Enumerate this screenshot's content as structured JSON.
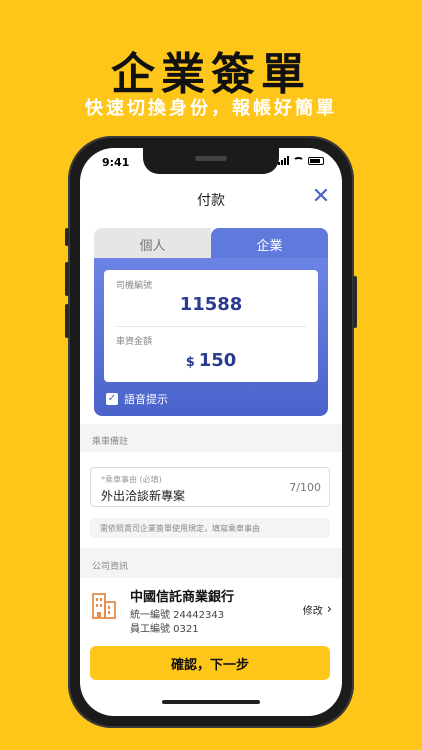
{
  "promo": {
    "headline": "企業簽單",
    "subline": "快速切換身份，報帳好簡單"
  },
  "status_bar": {
    "time": "9:41"
  },
  "nav": {
    "title": "付款"
  },
  "tabs": [
    {
      "label": "個人"
    },
    {
      "label": "企業"
    }
  ],
  "payment": {
    "driver_label": "司機編號",
    "driver_value": "11588",
    "fare_label": "車資金額",
    "currency": "$",
    "fare_value": "150",
    "voice_label": "語音提示",
    "voice_checked": true
  },
  "remarks": {
    "section_label": "乘車備註",
    "reason_placeholder": "*乘車事由 (必填)",
    "reason_value": "外出洽談新專案",
    "reason_count": "7/100",
    "note": "需依照貴司企業簽單使用規定，填寫乘車事由"
  },
  "company": {
    "section_label": "公司資訊",
    "name": "中國信託商業銀行",
    "tax_id": "統一編號 24442343",
    "employee_id": "員工編號 0321",
    "edit_label": "修改"
  },
  "actions": {
    "confirm_label": "確認，下一步"
  },
  "colors": {
    "accent_yellow": "#FFC61A",
    "brand_blue": "#5570D6"
  }
}
